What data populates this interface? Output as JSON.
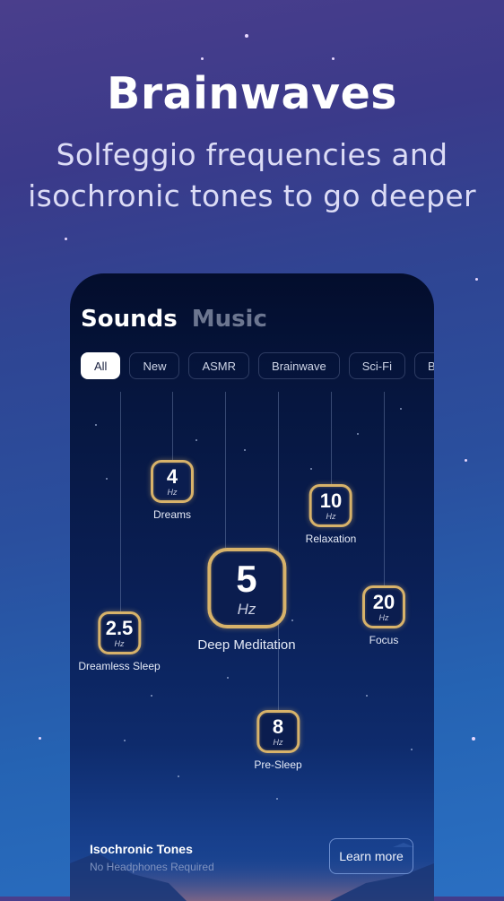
{
  "hero": {
    "title": "Brainwaves",
    "subtitle_line1": "Solfeggio frequencies and",
    "subtitle_line2": "isochronic tones to go deeper"
  },
  "app": {
    "tabs": [
      {
        "label": "Sounds",
        "active": true
      },
      {
        "label": "Music",
        "active": false
      }
    ],
    "filters": [
      {
        "label": "All",
        "active": true
      },
      {
        "label": "New",
        "active": false
      },
      {
        "label": "ASMR",
        "active": false
      },
      {
        "label": "Brainwave",
        "active": false
      },
      {
        "label": "Sci-Fi",
        "active": false
      },
      {
        "label": "Bab",
        "active": false
      }
    ],
    "frequencies": [
      {
        "value": "4",
        "unit": "Hz",
        "label": "Dreams"
      },
      {
        "value": "10",
        "unit": "Hz",
        "label": "Relaxation"
      },
      {
        "value": "5",
        "unit": "Hz",
        "label": "Deep Meditation",
        "featured": true
      },
      {
        "value": "2.5",
        "unit": "Hz",
        "label": "Dreamless Sleep"
      },
      {
        "value": "20",
        "unit": "Hz",
        "label": "Focus"
      },
      {
        "value": "8",
        "unit": "Hz",
        "label": "Pre-Sleep"
      }
    ],
    "footer": {
      "title": "Isochronic Tones",
      "subtitle": "No Headphones Required",
      "button_label": "Learn more"
    }
  },
  "colors": {
    "badge_border": "#d7b26a",
    "chip_active_bg": "#ffffff",
    "card_bg": "#06163f"
  }
}
